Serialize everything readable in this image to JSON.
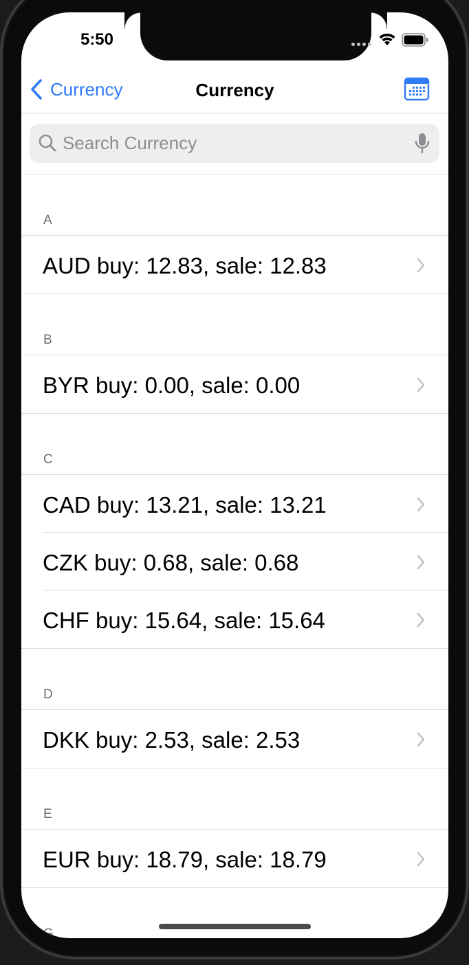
{
  "status_bar": {
    "time": "5:50"
  },
  "nav": {
    "back_label": "Currency",
    "title": "Currency",
    "right_icon": "calendar-icon"
  },
  "search": {
    "placeholder": "Search Currency",
    "value": ""
  },
  "sections": [
    {
      "letter": "A",
      "rows": [
        {
          "label": "AUD buy: 12.83, sale: 12.83"
        }
      ]
    },
    {
      "letter": "B",
      "rows": [
        {
          "label": "BYR buy: 0.00, sale: 0.00"
        }
      ]
    },
    {
      "letter": "C",
      "rows": [
        {
          "label": "CAD buy: 13.21, sale: 13.21"
        },
        {
          "label": "CZK buy: 0.68, sale: 0.68"
        },
        {
          "label": "CHF buy: 15.64, sale: 15.64"
        }
      ]
    },
    {
      "letter": "D",
      "rows": [
        {
          "label": "DKK buy: 2.53, sale: 2.53"
        }
      ]
    },
    {
      "letter": "E",
      "rows": [
        {
          "label": "EUR buy: 18.79, sale: 18.79"
        }
      ]
    },
    {
      "letter": "G",
      "rows": []
    }
  ],
  "colors": {
    "accent": "#2f7bf6",
    "background": "#ffffff",
    "separator": "#dcdce0",
    "secondary_text": "#6c6c70"
  }
}
